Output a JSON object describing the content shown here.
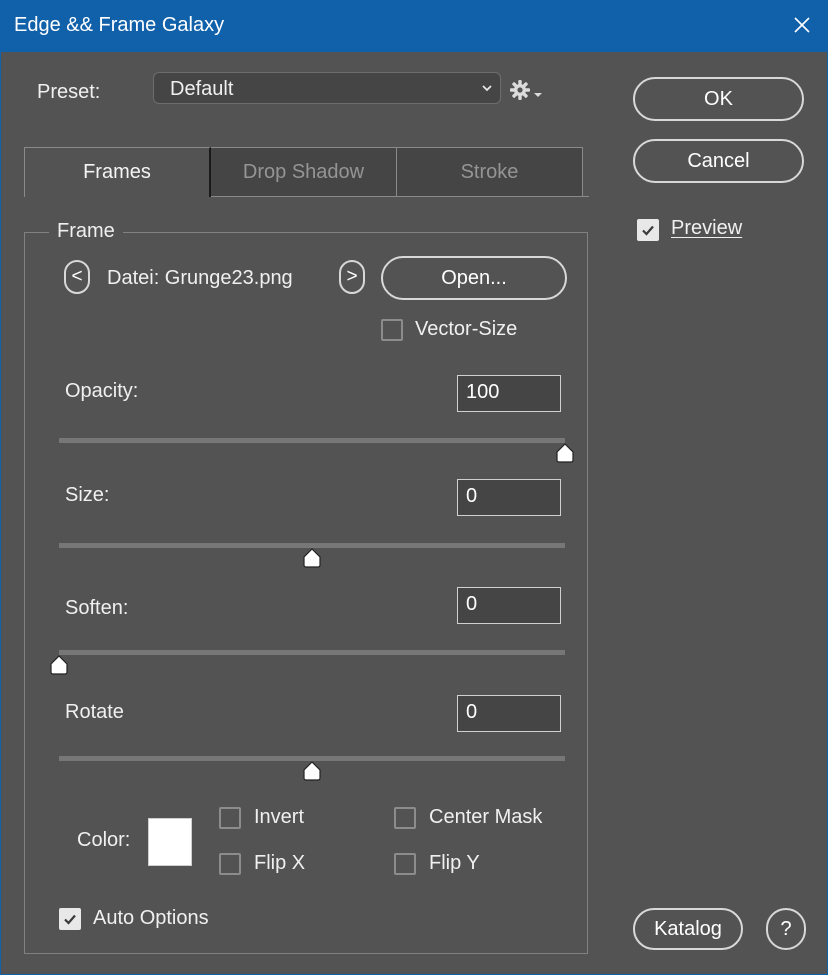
{
  "window": {
    "title": "Edge && Frame Galaxy"
  },
  "preset": {
    "label": "Preset:",
    "value": "Default"
  },
  "buttons": {
    "ok": "OK",
    "cancel": "Cancel",
    "katalog": "Katalog",
    "help": "?",
    "open": "Open...",
    "prev": "<",
    "next": ">"
  },
  "preview": {
    "label": "Preview",
    "checked": true
  },
  "tabs": [
    {
      "label": "Frames",
      "active": true
    },
    {
      "label": "Drop Shadow",
      "active": false
    },
    {
      "label": "Stroke",
      "active": false
    }
  ],
  "frame": {
    "legend": "Frame",
    "file_label": "Datei: Grunge23.png",
    "vector_size": {
      "label": "Vector-Size",
      "checked": false
    }
  },
  "sliders": {
    "opacity": {
      "label": "Opacity:",
      "value": "100",
      "fraction": 1.0
    },
    "size": {
      "label": "Size:",
      "value": "0",
      "fraction": 0.5
    },
    "soften": {
      "label": "Soften:",
      "value": "0",
      "fraction": 0.0
    },
    "rotate": {
      "label": "Rotate",
      "value": "0",
      "fraction": 0.5
    }
  },
  "color": {
    "label": "Color:",
    "value": "#ffffff"
  },
  "options": {
    "invert": {
      "label": "Invert",
      "checked": false
    },
    "center_mask": {
      "label": "Center Mask",
      "checked": false
    },
    "flip_x": {
      "label": "Flip X",
      "checked": false
    },
    "flip_y": {
      "label": "Flip Y",
      "checked": false
    },
    "auto_options": {
      "label": "Auto Options",
      "checked": true
    }
  },
  "colors": {
    "titlebar": "#1160aa",
    "panel": "#535353",
    "field": "#454545"
  }
}
